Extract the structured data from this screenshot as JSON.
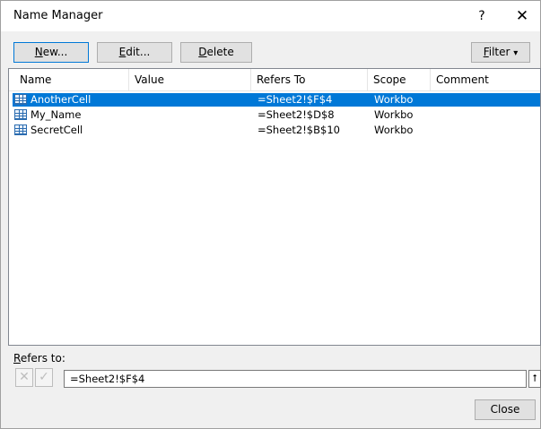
{
  "window": {
    "title": "Name Manager",
    "help": "?",
    "close": "✕"
  },
  "toolbar": {
    "new_u": "N",
    "new_rest": "ew...",
    "edit_u": "E",
    "edit_rest": "dit...",
    "delete_u": "D",
    "delete_rest": "elete",
    "filter_u": "F",
    "filter_rest": "ilter",
    "filter_arrow": "▾"
  },
  "columns": {
    "name": "Name",
    "value": "Value",
    "refers_to": "Refers To",
    "scope": "Scope",
    "comment": "Comment"
  },
  "rows": [
    {
      "name": "AnotherCell",
      "value": "",
      "refers_to": "=Sheet2!$F$4",
      "scope": "Workbo",
      "comment": "",
      "selected": true
    },
    {
      "name": "My_Name",
      "value": "",
      "refers_to": "=Sheet2!$D$8",
      "scope": "Workbo",
      "comment": "",
      "selected": false
    },
    {
      "name": "SecretCell",
      "value": "",
      "refers_to": "=Sheet2!$B$10",
      "scope": "Workbo",
      "comment": "",
      "selected": false
    }
  ],
  "refers": {
    "label_u": "R",
    "label_rest": "efers to:",
    "value": "=Sheet2!$F$4",
    "cancel_icon": "✕",
    "confirm_icon": "✓",
    "collapse_icon": "⭡"
  },
  "footer": {
    "close_label": "Close"
  }
}
